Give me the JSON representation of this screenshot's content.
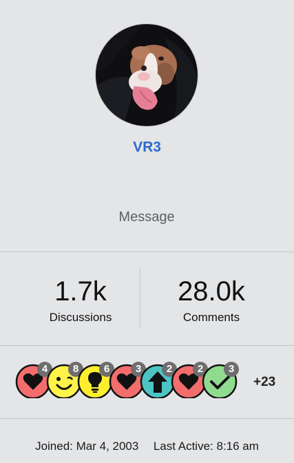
{
  "profile": {
    "username": "VR3",
    "avatar_alt": "dog-photo",
    "message_label": "Message"
  },
  "stats": [
    {
      "value": "1.7k",
      "label": "Discussions"
    },
    {
      "value": "28.0k",
      "label": "Comments"
    }
  ],
  "reactions": [
    {
      "icon": "heart-icon",
      "count": "4",
      "color": "#f46d6d"
    },
    {
      "icon": "smiley-icon",
      "count": "8",
      "color": "#fff34a"
    },
    {
      "icon": "lightbulb-icon",
      "count": "6",
      "color": "#ffee2e"
    },
    {
      "icon": "heart-icon",
      "count": "3",
      "color": "#f46d6d"
    },
    {
      "icon": "up-arrow-icon",
      "count": "2",
      "color": "#4cc4c4"
    },
    {
      "icon": "heart-icon",
      "count": "2",
      "color": "#f46d6d"
    },
    {
      "icon": "checkmark-icon",
      "count": "3",
      "color": "#8fdc8f"
    }
  ],
  "reactions_more": "+23",
  "meta": {
    "joined_label": "Joined:",
    "joined_date": "Mar 4, 2003",
    "active_label": "Last Active:",
    "active_time": "8:16 am"
  }
}
